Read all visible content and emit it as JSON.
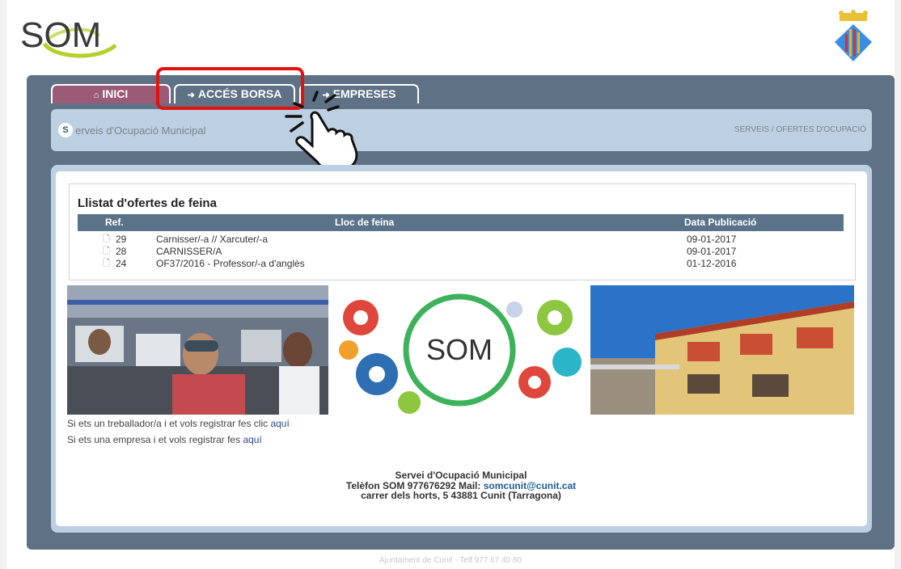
{
  "brand": {
    "logo_text": "SOM"
  },
  "tabs": [
    {
      "icon": "home-icon",
      "glyph": "⌂",
      "label": "INICI"
    },
    {
      "icon": "sign-in-icon",
      "glyph": "➜",
      "label": "ACCÉS BORSA"
    },
    {
      "icon": "sign-in-icon",
      "glyph": "➜",
      "label": "EMPRESES"
    }
  ],
  "header": {
    "badge": "S",
    "site_title": "erveis d'Ocupació Municipal",
    "breadcrumb": "SERVEIS / OFERTES D'OCUPACIÓ"
  },
  "offers": {
    "title": "Llistat d'ofertes de feina",
    "columns": [
      "Ref.",
      "Lloc de feina",
      "Data Publicació"
    ],
    "rows": [
      {
        "ref": "29",
        "lloc": "Carnisser/-a // Xarcuter/-a",
        "data": "09-01-2017"
      },
      {
        "ref": "28",
        "lloc": "CARNISSER/A",
        "data": "09-01-2017"
      },
      {
        "ref": "24",
        "lloc": "OF37/2016 - Professor/-a d'anglès",
        "data": "01-12-2016"
      }
    ]
  },
  "banner": {
    "center_logo": "SOM"
  },
  "register": {
    "worker_text": "Si ets un treballador/a i et vols registrar fes clic ",
    "worker_link": "aquí",
    "company_text": "Si ets una empresa i et vols registrar fes ",
    "company_link": "aquí"
  },
  "footer": {
    "name": "Servei d'Ocupació Municipal",
    "phone_text": "Telèfon SOM 977676292 Mail: ",
    "email": "somcunit@cunit.cat",
    "address": "carrer dels horts, 5 43881 Cunit (Tarragona)",
    "bottom": "Ajuntament de Cunit - Telf.977 67 40 80"
  },
  "colors": {
    "frame": "#5e7185",
    "active_tab": "#9b5a76",
    "highlight": "#e4120f",
    "light_panel": "#bdd0e2"
  }
}
